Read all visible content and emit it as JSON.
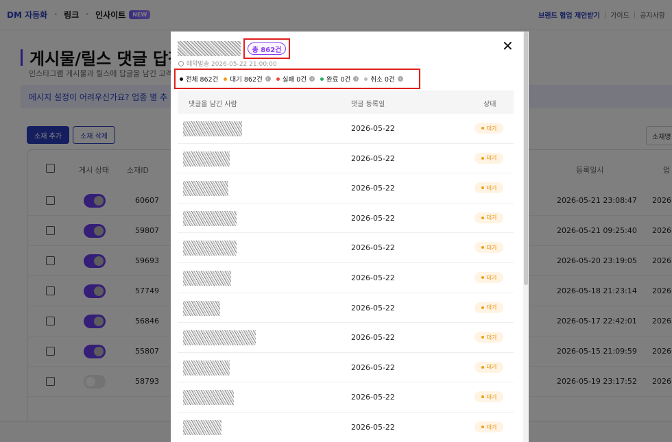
{
  "topnav": {
    "logo": "DM 자동화",
    "links": [
      "링크",
      "인사이트"
    ],
    "new_badge": "NEW",
    "right_links": [
      "브랜드 협업 제안받기",
      "가이드",
      "공지사항"
    ]
  },
  "page": {
    "title": "게시물/릴스 댓글 답장",
    "subtitle": "인스타그램 게시물과 릴스에 답글을 남긴 고객",
    "banner": "메시지 설정이 어려우신가요? 업종 별 추",
    "btn_add": "소재 추가",
    "btn_delete": "소재 삭제",
    "btn_right": "소재명",
    "columns": [
      "게시 상태",
      "소재ID",
      "등록일시",
      "업"
    ],
    "rows": [
      {
        "id": "60607",
        "on": true,
        "date": "2026-05-21 23:08:47",
        "cut": "2026"
      },
      {
        "id": "59807",
        "on": true,
        "date": "2026-05-21 09:25:40",
        "cut": "2026"
      },
      {
        "id": "59693",
        "on": true,
        "date": "2026-05-20 23:19:05",
        "cut": "2026"
      },
      {
        "id": "57749",
        "on": true,
        "date": "2026-05-18 21:23:14",
        "cut": "2026"
      },
      {
        "id": "56846",
        "on": true,
        "date": "2026-05-17 22:42:01",
        "cut": "2026"
      },
      {
        "id": "55807",
        "on": true,
        "date": "2026-05-15 21:09:59",
        "cut": "2026"
      },
      {
        "id": "58793",
        "on": false,
        "date": "2026-05-19 23:17:52",
        "cut": "2026"
      }
    ],
    "left_time": ":00"
  },
  "modal": {
    "total": "총 862건",
    "schedule": "예약발송 2026-05-22 21:00:00",
    "close": "✕",
    "stats": [
      {
        "label": "전체 862건",
        "color": "#111111"
      },
      {
        "label": "대기 862건",
        "color": "#f39c12"
      },
      {
        "label": "실패 0건",
        "color": "#e74c3c"
      },
      {
        "label": "완료 0건",
        "color": "#27ae60"
      },
      {
        "label": "취소 0건",
        "color": "#bbbbbb"
      }
    ],
    "headers": [
      "댓글을 남긴 사람",
      "댓글 등록일",
      "상태"
    ],
    "row_date": "2026-05-22",
    "row_status": "대기",
    "row_count": 11
  }
}
